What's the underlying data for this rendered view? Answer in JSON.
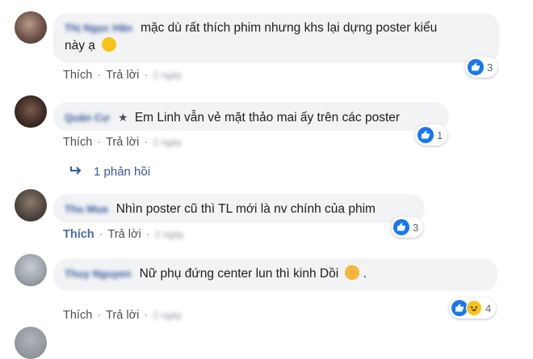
{
  "comments": [
    {
      "text": "mặc dù rất thích phim nhưng khs lại dựng poster kiểu này ạ",
      "line1": "mặc dù rất thích phim nhưng khs lại dựng poster kiểu",
      "line2": "này ạ",
      "emoji": "smile-emoji",
      "reaction_count": "3",
      "like_label": "Thích",
      "reply_label": "Trả lời"
    },
    {
      "text": "Em Linh vẫn vẻ mặt thảo mai ấy trên các poster",
      "reaction_count": "1",
      "like_label": "Thích",
      "reply_label": "Trả lời",
      "replies_label": "1 phản hồi"
    },
    {
      "text": "Nhìn poster cũ thì TL mới là nv chính của phim",
      "reaction_count": "3",
      "like_label": "Thích",
      "reply_label": "Trả lời"
    },
    {
      "text": "Nữ phụ đứng center lun thì kinh Dồi",
      "end": ".",
      "emoji": "blush-emoji",
      "reaction_count": "4",
      "like_label": "Thích",
      "reply_label": "Trả lời"
    }
  ],
  "colors": {
    "like_blue": "#1877f2",
    "bubble_bg": "#f2f3f5",
    "link": "#365899"
  }
}
